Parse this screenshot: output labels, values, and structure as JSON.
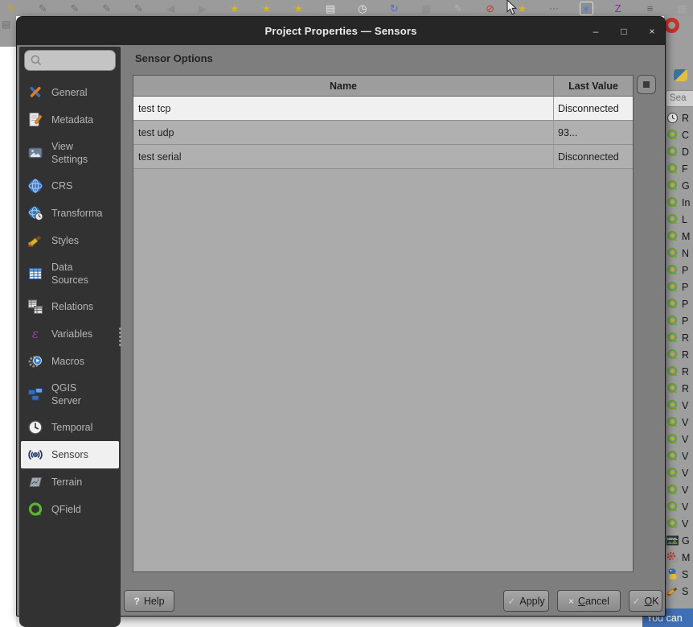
{
  "window": {
    "title": "Project Properties — Sensors",
    "minimize": "–",
    "maximize": "□",
    "close": "×"
  },
  "sidebar": {
    "search_text": "",
    "items": [
      {
        "label": "General",
        "icon": "tools-icon"
      },
      {
        "label": "Metadata",
        "icon": "metadata-icon"
      },
      {
        "label": "View Settings",
        "icon": "view-settings-icon",
        "two_line": true
      },
      {
        "label": "CRS",
        "icon": "globe-icon"
      },
      {
        "label": "Transforma",
        "icon": "globe-clock-icon"
      },
      {
        "label": "Styles",
        "icon": "brush-icon"
      },
      {
        "label": "Data Sources",
        "icon": "data-table-icon",
        "two_line": true
      },
      {
        "label": "Relations",
        "icon": "relations-icon"
      },
      {
        "label": "Variables",
        "icon": "epsilon-icon"
      },
      {
        "label": "Macros",
        "icon": "gear-play-icon"
      },
      {
        "label": "QGIS Server",
        "icon": "server-icon",
        "two_line": true
      },
      {
        "label": "Temporal",
        "icon": "clock-icon"
      },
      {
        "label": "Sensors",
        "icon": "sensor-waves-icon",
        "selected": true
      },
      {
        "label": "Terrain",
        "icon": "terrain-icon"
      },
      {
        "label": "QField",
        "icon": "qfield-icon"
      }
    ]
  },
  "content": {
    "heading": "Sensor Options",
    "table": {
      "columns": [
        "Name",
        "Last Value"
      ],
      "rows": [
        {
          "name": "test tcp",
          "last_value": "Disconnected"
        },
        {
          "name": "test udp",
          "last_value": "93..."
        },
        {
          "name": "test serial",
          "last_value": "Disconnected"
        }
      ]
    }
  },
  "footer": {
    "help": "Help",
    "help_glyph": "?",
    "apply": "Apply",
    "apply_glyph": "✓",
    "cancel_mn": "C",
    "cancel_rest": "ancel",
    "cancel_glyph": "×",
    "ok_mn": "O",
    "ok_rest": "K",
    "ok_glyph": "✓"
  },
  "background": {
    "statusbar_tip": "You can",
    "panel_search": "Sea",
    "panel_items": [
      {
        "letter": "R",
        "icon": "clock-small-icon"
      },
      {
        "letter": "C",
        "icon": "q-logo-icon"
      },
      {
        "letter": "D",
        "icon": "q-logo-icon"
      },
      {
        "letter": "F",
        "icon": "q-logo-icon"
      },
      {
        "letter": "G",
        "icon": "q-logo-icon"
      },
      {
        "letter": "In",
        "icon": "q-logo-icon"
      },
      {
        "letter": "L",
        "icon": "q-logo-icon"
      },
      {
        "letter": "M",
        "icon": "q-logo-icon"
      },
      {
        "letter": "N",
        "icon": "q-logo-icon"
      },
      {
        "letter": "P",
        "icon": "q-logo-icon"
      },
      {
        "letter": "P",
        "icon": "q-logo-icon"
      },
      {
        "letter": "P",
        "icon": "q-logo-icon"
      },
      {
        "letter": "P",
        "icon": "q-logo-icon"
      },
      {
        "letter": "R",
        "icon": "q-logo-icon"
      },
      {
        "letter": "R",
        "icon": "q-logo-icon"
      },
      {
        "letter": "R",
        "icon": "q-logo-icon"
      },
      {
        "letter": "R",
        "icon": "q-logo-icon"
      },
      {
        "letter": "V",
        "icon": "q-logo-icon"
      },
      {
        "letter": "V",
        "icon": "q-logo-icon"
      },
      {
        "letter": "V",
        "icon": "q-logo-icon"
      },
      {
        "letter": "V",
        "icon": "q-logo-icon"
      },
      {
        "letter": "V",
        "icon": "q-logo-icon"
      },
      {
        "letter": "V",
        "icon": "q-logo-icon"
      },
      {
        "letter": "V",
        "icon": "q-logo-icon"
      },
      {
        "letter": "V",
        "icon": "q-logo-icon"
      },
      {
        "letter": "G",
        "icon": "gdal-icon"
      },
      {
        "letter": "M",
        "icon": "gear-red-icon"
      },
      {
        "letter": "S",
        "icon": "python-icon"
      },
      {
        "letter": "S",
        "icon": "brush-small-icon"
      }
    ],
    "toolbar_icons": [
      {
        "name": "edit-pen-yellow-icon",
        "glyph": "✎",
        "color": "#c9a227"
      },
      {
        "name": "edit-pen-icon",
        "glyph": "✎",
        "color": "#6f6f6f"
      },
      {
        "name": "edit-pen-icon",
        "glyph": "✎",
        "color": "#6f6f6f"
      },
      {
        "name": "edit-pen-icon",
        "glyph": "✎",
        "color": "#6f6f6f"
      },
      {
        "name": "edit-pen-icon",
        "glyph": "✎",
        "color": "#6f6f6f"
      },
      {
        "name": "undo-icon",
        "glyph": "◀",
        "color": "#8d8d8d"
      },
      {
        "name": "redo-icon",
        "glyph": "▶",
        "color": "#8d8d8d"
      },
      {
        "name": "label-star-icon",
        "glyph": "★",
        "color": "#d8b51c"
      },
      {
        "name": "label-star-icon",
        "glyph": "★",
        "color": "#d8b51c"
      },
      {
        "name": "label-star-icon",
        "glyph": "★",
        "color": "#d8b51c"
      },
      {
        "name": "new-layout-icon",
        "glyph": "▤",
        "color": "#e8e8e8"
      },
      {
        "name": "temporal-clock-icon",
        "glyph": "◷",
        "color": "#ededed"
      },
      {
        "name": "refresh-icon",
        "glyph": "↻",
        "color": "#3f74c2"
      },
      {
        "name": "measure-icon",
        "glyph": "▦",
        "color": "#8d8d8d"
      },
      {
        "name": "edit-pen-faded-icon",
        "glyph": "✎",
        "color": "#b3b3b3"
      },
      {
        "name": "label-off-icon",
        "glyph": "⊘",
        "color": "#c43b31"
      },
      {
        "name": "label-pin-icon",
        "glyph": "★",
        "color": "#d8b51c"
      },
      {
        "name": "more-dots-icon",
        "glyph": "⋯",
        "color": "#6f6f6f"
      },
      {
        "name": "processing-star-icon",
        "glyph": "∗",
        "color": "#4a7fd4",
        "boxed": true
      },
      {
        "name": "z-tool-icon",
        "glyph": "Z",
        "color": "#8a2d9e"
      },
      {
        "name": "list-icon",
        "glyph": "≡",
        "color": "#5a5a5a"
      },
      {
        "name": "ruler-icon",
        "glyph": "▦",
        "color": "#a5a5a5"
      }
    ]
  },
  "colors": {
    "titlebar": "#262626",
    "dialog": "#7e7e7e",
    "sidebar": "#323232",
    "selected": "#f0f0f0",
    "header": "#9d9d9d",
    "row": "#b0b0b0",
    "row-alt": "#f0f0f0",
    "status-blue": "#3f6fb5"
  }
}
